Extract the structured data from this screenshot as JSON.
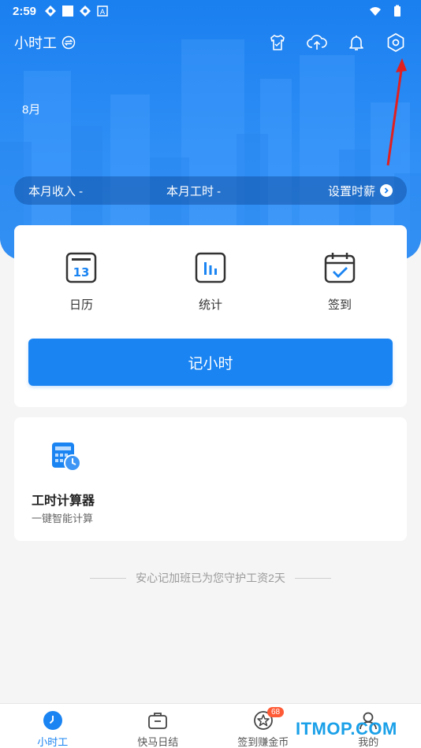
{
  "status_bar": {
    "time": "2:59"
  },
  "header": {
    "app_title": "小时工",
    "month": "8月",
    "summary": {
      "income_label": "本月收入 -",
      "hours_label": "本月工时 -",
      "set_wage_label": "设置时薪"
    },
    "icons": [
      "shirt-icon",
      "cloud-upload-icon",
      "bell-icon",
      "settings-icon"
    ]
  },
  "features": [
    {
      "label": "日历",
      "icon": "calendar-icon",
      "day": "13"
    },
    {
      "label": "统计",
      "icon": "stats-icon"
    },
    {
      "label": "签到",
      "icon": "checkin-icon"
    }
  ],
  "record_button": "记小时",
  "calculator": {
    "title": "工时计算器",
    "subtitle": "一键智能计算"
  },
  "guard_text": "安心记加班已为您守护工资2天",
  "tabs": [
    {
      "label": "小时工",
      "icon": "clock-icon"
    },
    {
      "label": "快马日结",
      "icon": "briefcase-icon"
    },
    {
      "label": "签到赚金币",
      "icon": "coin-star-icon",
      "badge": "68"
    },
    {
      "label": "我的",
      "icon": "user-icon"
    }
  ],
  "watermark": "ITMOP.COM",
  "colors": {
    "primary": "#1a84f2",
    "badge": "#ff5a36"
  }
}
